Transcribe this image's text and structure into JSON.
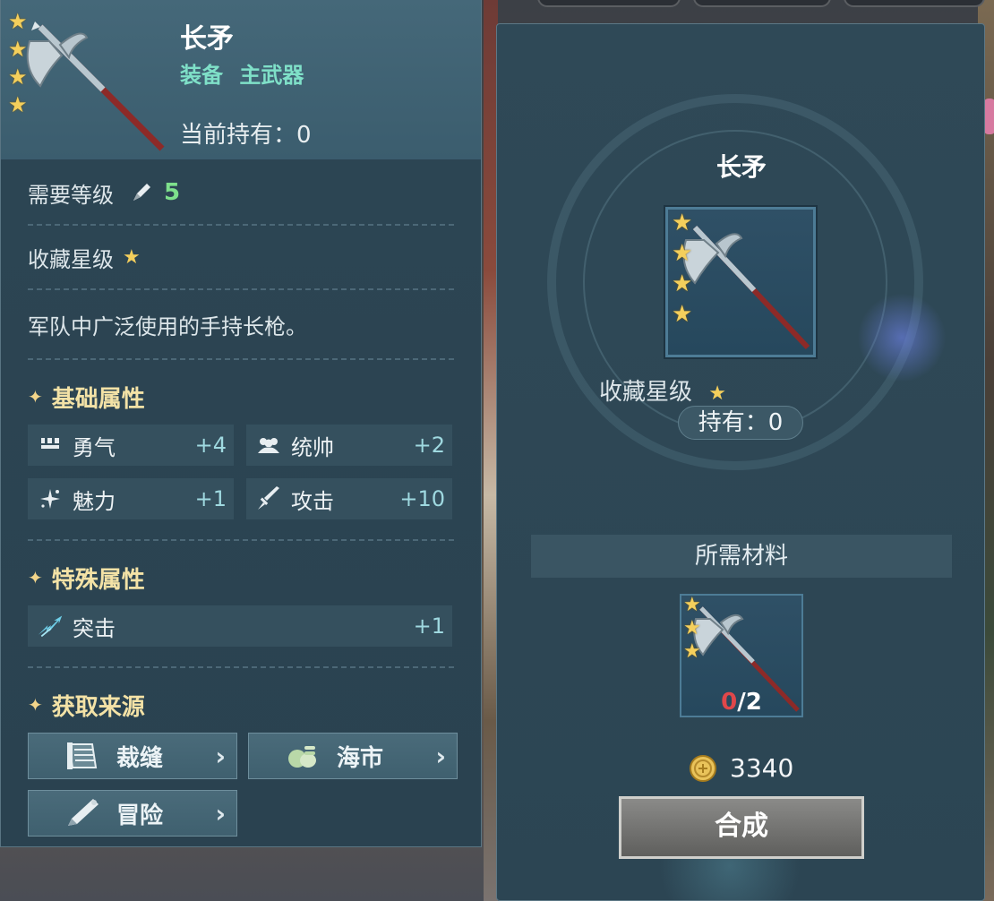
{
  "item": {
    "name": "长矛",
    "type_primary": "装备",
    "type_secondary": "主武器",
    "hold_label": "当前持有：",
    "hold_value": "0",
    "star_count_art": 4
  },
  "details": {
    "req_level_label": "需要等级",
    "req_level_value": "5",
    "collect_star_label": "收藏星级",
    "description": "军队中广泛使用的手持长枪。"
  },
  "sections": {
    "basic": "基础属性",
    "special": "特殊属性",
    "source": "获取来源"
  },
  "basic_attrs": [
    {
      "name": "勇气",
      "value": "+4",
      "icon": "courage-icon"
    },
    {
      "name": "统帅",
      "value": "+2",
      "icon": "leadership-icon"
    },
    {
      "name": "魅力",
      "value": "+1",
      "icon": "charm-icon"
    },
    {
      "name": "攻击",
      "value": "+10",
      "icon": "sword-icon"
    }
  ],
  "special_attrs": [
    {
      "name": "突击",
      "value": "+1",
      "icon": "charge-icon"
    }
  ],
  "sources": [
    {
      "name": "裁缝",
      "icon": "tailor-icon"
    },
    {
      "name": "海市",
      "icon": "market-icon"
    },
    {
      "name": "冒险",
      "icon": "adventure-icon"
    }
  ],
  "craft": {
    "title": "长矛",
    "collect_star_label": "收藏星级",
    "hold_label": "持有：",
    "hold_value": "0",
    "materials_label": "所需材料",
    "material_have": "0",
    "material_need": "/2",
    "cost": "3340",
    "button_label": "合成"
  },
  "colors": {
    "star": "#f4cf5c",
    "level_value": "#7ee08c",
    "type_text": "#7fe0c8",
    "section_title": "#f3e2a6",
    "insufficient": "#e0474a"
  }
}
